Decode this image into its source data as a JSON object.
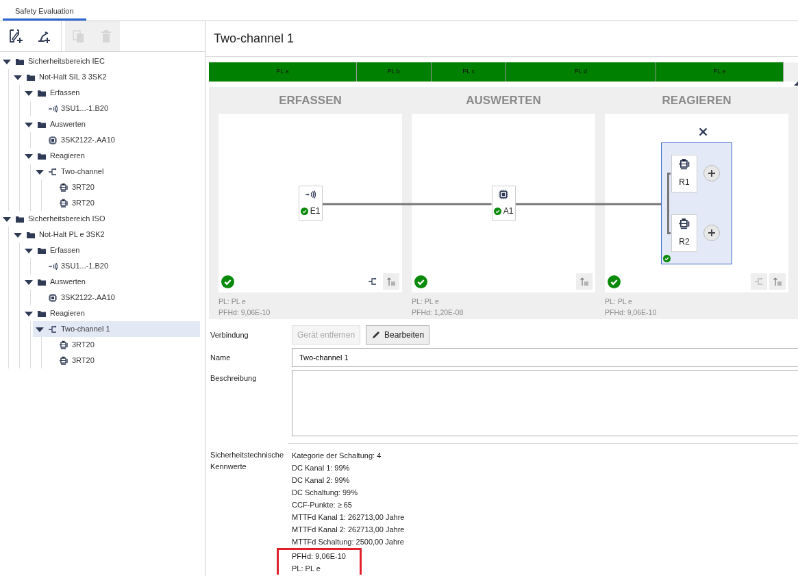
{
  "tabs": [
    {
      "label": "Safety Evaluation",
      "selected": true
    }
  ],
  "toolbar": [
    {
      "kind": "new-area",
      "disabled": false
    },
    {
      "kind": "new-function",
      "disabled": false
    },
    {
      "kind": "copy",
      "disabled": true
    },
    {
      "kind": "delete",
      "disabled": true
    }
  ],
  "tree": [
    {
      "label": "Sicherheitsbereich IEC",
      "kind": "folder",
      "expanded": true,
      "selected": false,
      "children": [
        {
          "label": "Not-Halt SIL 3 3SK2",
          "kind": "folder",
          "expanded": true,
          "selected": false,
          "children": [
            {
              "label": "Erfassen",
              "kind": "folder",
              "expanded": true,
              "selected": false,
              "children": [
                {
                  "label": "3SU1...-1.B20",
                  "kind": "sensor",
                  "selected": false
                }
              ]
            },
            {
              "label": "Auswerten",
              "kind": "folder",
              "expanded": true,
              "selected": false,
              "children": [
                {
                  "label": "3SK2122-.AA10",
                  "kind": "chip",
                  "selected": false
                }
              ]
            },
            {
              "label": "Reagieren",
              "kind": "folder",
              "expanded": true,
              "selected": false,
              "children": [
                {
                  "label": "Two-channel",
                  "kind": "branch",
                  "expanded": true,
                  "selected": false,
                  "children": [
                    {
                      "label": "3RT20",
                      "kind": "motor",
                      "selected": false
                    },
                    {
                      "label": "3RT20",
                      "kind": "motor",
                      "selected": false
                    }
                  ]
                }
              ]
            }
          ]
        }
      ]
    },
    {
      "label": "Sicherheitsbereich ISO",
      "kind": "folder",
      "expanded": true,
      "selected": false,
      "children": [
        {
          "label": "Not-Halt PL e 3SK2",
          "kind": "folder",
          "expanded": true,
          "selected": false,
          "children": [
            {
              "label": "Erfassen",
              "kind": "folder",
              "expanded": true,
              "selected": false,
              "children": [
                {
                  "label": "3SU1...-1.B20",
                  "kind": "sensor",
                  "selected": false
                }
              ]
            },
            {
              "label": "Auswerten",
              "kind": "folder",
              "expanded": true,
              "selected": false,
              "children": [
                {
                  "label": "3SK2122-.AA10",
                  "kind": "chip",
                  "selected": false
                }
              ]
            },
            {
              "label": "Reagieren",
              "kind": "folder",
              "expanded": true,
              "selected": false,
              "children": [
                {
                  "label": "Two-channel 1",
                  "kind": "branch",
                  "expanded": true,
                  "selected": true,
                  "children": [
                    {
                      "label": "3RT20",
                      "kind": "motor",
                      "selected": false
                    },
                    {
                      "label": "3RT20",
                      "kind": "motor",
                      "selected": false
                    }
                  ]
                }
              ]
            }
          ]
        }
      ]
    }
  ],
  "detail": {
    "title": "Two-channel 1",
    "pl_scale": {
      "level": 0.976,
      "segments": [
        {
          "label": "PL a"
        },
        {
          "label": "PL b"
        },
        {
          "label": "PL c"
        },
        {
          "label": "PL d"
        },
        {
          "label": "PL e"
        }
      ]
    },
    "diagram": {
      "columns": [
        {
          "heading": "ERFASSEN",
          "ok": true,
          "pl": "PL: PL e",
          "pfhd": "PFHd: 9,06E-10",
          "actions": [
            {
              "kind": "branch",
              "disabled": false
            },
            {
              "kind": "sort",
              "disabled": false
            }
          ],
          "nodes": [
            {
              "kind": "sensor",
              "label": "E1",
              "ok": true
            }
          ]
        },
        {
          "heading": "AUSWERTEN",
          "ok": true,
          "pl": "PL: PL e",
          "pfhd": "PFHd: 1,20E-08",
          "actions": [
            {
              "kind": "sort",
              "disabled": false
            }
          ],
          "nodes": [
            {
              "kind": "chip",
              "label": "A1",
              "ok": true
            }
          ]
        },
        {
          "heading": "REAGIEREN",
          "ok": true,
          "pl": "PL: PL e",
          "pfhd": "PFHd: 9,06E-10",
          "actions": [
            {
              "kind": "branch",
              "disabled": true
            },
            {
              "kind": "sort",
              "disabled": false
            }
          ],
          "group": {
            "selected": true,
            "ok": true,
            "nodes": [
              {
                "kind": "motor",
                "label": "R1"
              },
              {
                "kind": "motor",
                "label": "R2"
              }
            ]
          }
        }
      ]
    },
    "connection": {
      "label": "Verbindung",
      "buttons": [
        {
          "label": "Gerät entfernen",
          "kind": "plain",
          "disabled": true
        },
        {
          "label": "Bearbeiten",
          "kind": "edit",
          "disabled": false
        }
      ]
    },
    "name": {
      "label": "Name",
      "value": "Two-channel 1"
    },
    "description": {
      "label": "Beschreibung"
    },
    "values": {
      "label": "Sicherheitstechnische Kennwerte",
      "items": [
        {
          "text": "Kategorie der Schaltung: 4",
          "highlighted": false
        },
        {
          "text": "DC Kanal 1: 99%",
          "highlighted": false
        },
        {
          "text": "DC Kanal 2: 99%",
          "highlighted": false
        },
        {
          "text": "DC Schaltung: 99%",
          "highlighted": false
        },
        {
          "text": "CCF-Punkte: ≥ 65",
          "highlighted": false
        },
        {
          "text": "MTTFd Kanal 1: 262713,00 Jahre",
          "highlighted": false
        },
        {
          "text": "MTTFd Kanal 2: 262713,00 Jahre",
          "highlighted": false
        },
        {
          "text": "MTTFd Schaltung: 2500,00 Jahre",
          "highlighted": false
        },
        {
          "text": "PFHd: 9,06E-10",
          "highlighted": true
        },
        {
          "text": "PL: PL e",
          "highlighted": true
        }
      ]
    }
  }
}
